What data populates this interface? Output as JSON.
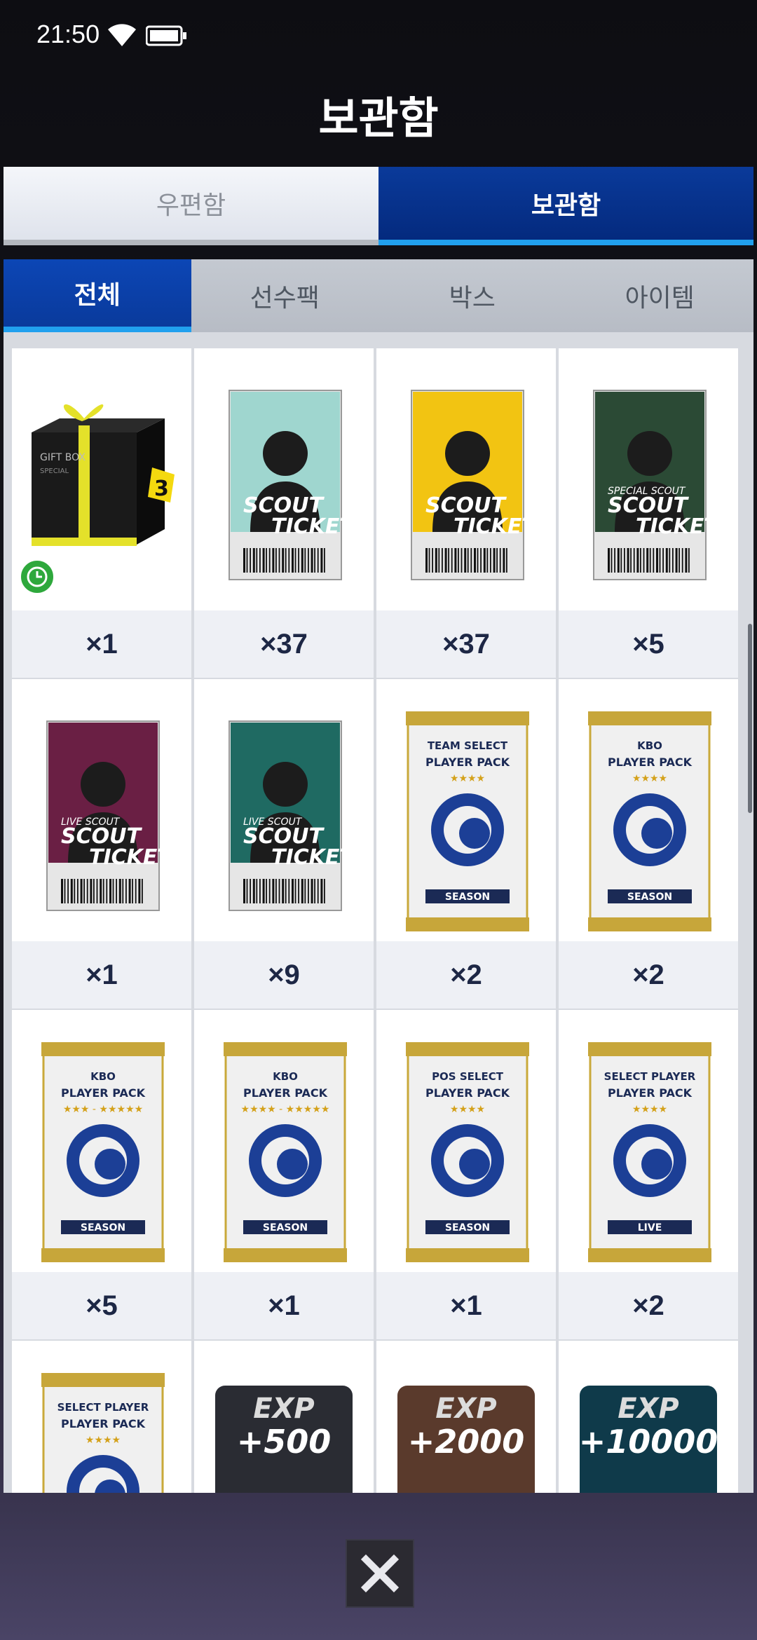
{
  "status": {
    "time": "21:50"
  },
  "title": "보관함",
  "top_tabs": [
    {
      "label": "우편함",
      "active": false
    },
    {
      "label": "보관함",
      "active": true
    }
  ],
  "sub_tabs": [
    {
      "label": "전체",
      "active": true
    },
    {
      "label": "선수팩",
      "active": false
    },
    {
      "label": "박스",
      "active": false
    },
    {
      "label": "아이템",
      "active": false
    }
  ],
  "items": [
    {
      "kind": "gift-box",
      "qty": "×1",
      "box_text": "GIFT BOX",
      "box_sub": "SPECIAL",
      "badge": "3"
    },
    {
      "kind": "scout-ticket",
      "qty": "×37",
      "line1": "SCOUT",
      "line2": "TICKET",
      "color": "#9fd6cf"
    },
    {
      "kind": "scout-ticket",
      "qty": "×37",
      "line1": "SCOUT",
      "line2": "TICKET",
      "color": "#f2c412"
    },
    {
      "kind": "scout-ticket",
      "qty": "×5",
      "line1": "SCOUT",
      "line2": "TICKET",
      "color": "#2b4a35",
      "tag": "SPECIAL SCOUT"
    },
    {
      "kind": "scout-ticket",
      "qty": "×1",
      "line1": "SCOUT",
      "line2": "TICKET",
      "color": "#6a1f44",
      "tag": "LIVE SCOUT"
    },
    {
      "kind": "scout-ticket",
      "qty": "×9",
      "line1": "SCOUT",
      "line2": "TICKET",
      "color": "#1f6a62",
      "tag": "LIVE SCOUT"
    },
    {
      "kind": "player-pack",
      "qty": "×2",
      "top": "TEAM SELECT",
      "name": "PLAYER PACK",
      "stars": "★★★★",
      "bottom": "SEASON"
    },
    {
      "kind": "player-pack",
      "qty": "×2",
      "top": "KBO",
      "name": "PLAYER PACK",
      "stars": "★★★★",
      "bottom": "SEASON"
    },
    {
      "kind": "player-pack",
      "qty": "×5",
      "top": "KBO",
      "name": "PLAYER PACK",
      "stars": "★★★ - ★★★★★",
      "bottom": "SEASON"
    },
    {
      "kind": "player-pack",
      "qty": "×1",
      "top": "KBO",
      "name": "PLAYER PACK",
      "stars": "★★★★ - ★★★★★",
      "bottom": "SEASON"
    },
    {
      "kind": "player-pack",
      "qty": "×1",
      "top": "POS SELECT",
      "name": "PLAYER PACK",
      "stars": "★★★★",
      "bottom": "SEASON"
    },
    {
      "kind": "player-pack",
      "qty": "×2",
      "top": "SELECT PLAYER",
      "name": "PLAYER PACK",
      "stars": "★★★★",
      "bottom": "LIVE"
    },
    {
      "kind": "player-pack",
      "qty": "",
      "top": "SELECT PLAYER",
      "name": "PLAYER PACK",
      "stars": "★★★★",
      "bottom": ""
    },
    {
      "kind": "exp",
      "qty": "",
      "line1": "EXP",
      "line2": "+500",
      "color": "#2a2c33"
    },
    {
      "kind": "exp",
      "qty": "",
      "line1": "EXP",
      "line2": "+2000",
      "color": "#5a3a2c"
    },
    {
      "kind": "exp",
      "qty": "",
      "line1": "EXP",
      "line2": "+10000",
      "color": "#0f3a4a"
    }
  ],
  "colors": {
    "accent_blue": "#0a3a9c",
    "accent_underline": "#21a0ee",
    "qty_text": "#1d2745"
  }
}
